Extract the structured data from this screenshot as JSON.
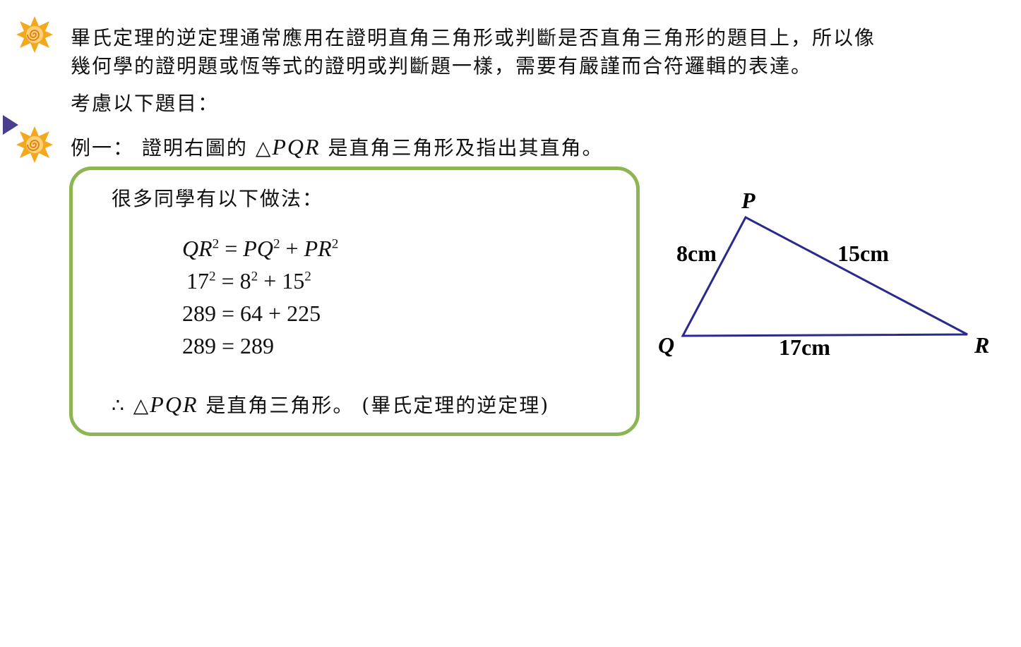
{
  "intro": {
    "line1": "畢氏定理的逆定理通常應用在證明直角三角形或判斷是否直角三角形的題目上，所以像",
    "line2": "幾何學的證明題或恆等式的證明或判斷題一樣，需要有嚴謹而合符邏輯的表達。",
    "line3": "考慮以下題目："
  },
  "example": {
    "prefix": "例一： 證明右圖的 ",
    "triangle_symbol": "△",
    "triangle_name": "PQR",
    "suffix": " 是直角三角形及指出其直角。"
  },
  "box": {
    "heading": "很多同學有以下做法：",
    "eq1": {
      "a": "QR",
      "b": "PQ",
      "c": "PR",
      "exp": "2",
      "eq": " = ",
      "plus": " + "
    },
    "eq2": {
      "a": "17",
      "b": "8",
      "c": "15",
      "exp": "2",
      "eq": " = ",
      "plus": " + "
    },
    "eq3": "289 = 64 + 225",
    "eq4": "289 = 289",
    "conclusion": {
      "therefore": "∴",
      "symbol": "△",
      "name": "PQR",
      "text": " 是直角三角形。",
      "note": " (畢氏定理的逆定理)"
    }
  },
  "figure": {
    "vertex_p": "P",
    "vertex_q": "Q",
    "vertex_r": "R",
    "side_pq": "8cm",
    "side_pr": "15cm",
    "side_qr": "17cm",
    "line_color": "#2a2a8c"
  },
  "colors": {
    "box_border": "#8db552",
    "icon_orange": "#f4a81d",
    "play_arrow": "#4a3f8c"
  }
}
